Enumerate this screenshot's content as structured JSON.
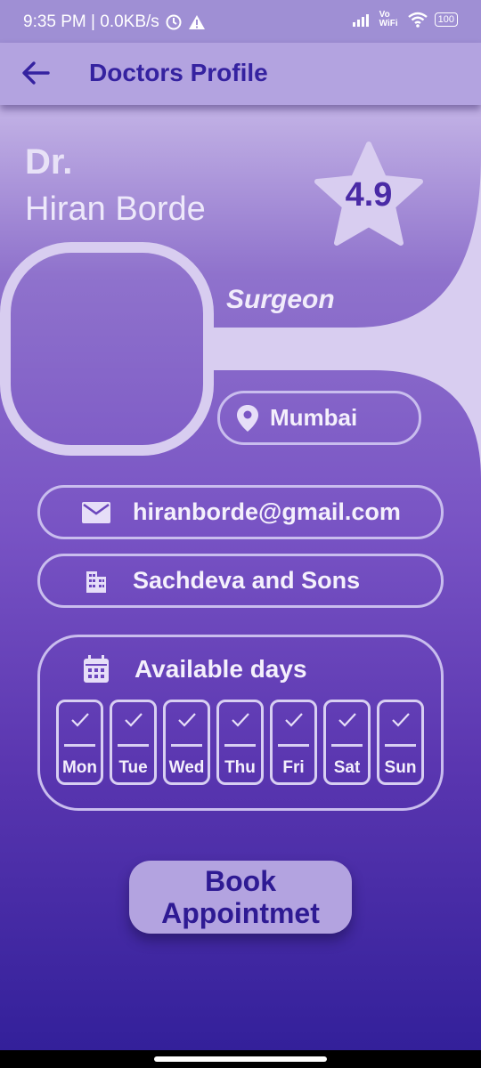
{
  "status_bar": {
    "time_speed": "9:35 PM | 0.0KB/s",
    "network": "Vo WiFi",
    "battery": "100"
  },
  "app_bar": {
    "title": "Doctors Profile"
  },
  "profile": {
    "prefix": "Dr.",
    "name": "Hiran Borde",
    "rating": "4.9",
    "specialty": "Surgeon",
    "location": "Mumbai",
    "email": "hiranborde@gmail.com",
    "company": "Sachdeva and Sons"
  },
  "availability": {
    "heading": "Available days",
    "days": [
      {
        "label": "Mon",
        "available": true
      },
      {
        "label": "Tue",
        "available": true
      },
      {
        "label": "Wed",
        "available": true
      },
      {
        "label": "Thu",
        "available": true
      },
      {
        "label": "Fri",
        "available": true
      },
      {
        "label": "Sat",
        "available": true
      },
      {
        "label": "Sun",
        "available": true
      }
    ]
  },
  "book_button": {
    "label_line1": "Book",
    "label_line2": "Appointmet"
  },
  "colors": {
    "accent": "#3522a0",
    "app_bar": "#b3a3e0",
    "shape_light": "#d8cdf0"
  }
}
